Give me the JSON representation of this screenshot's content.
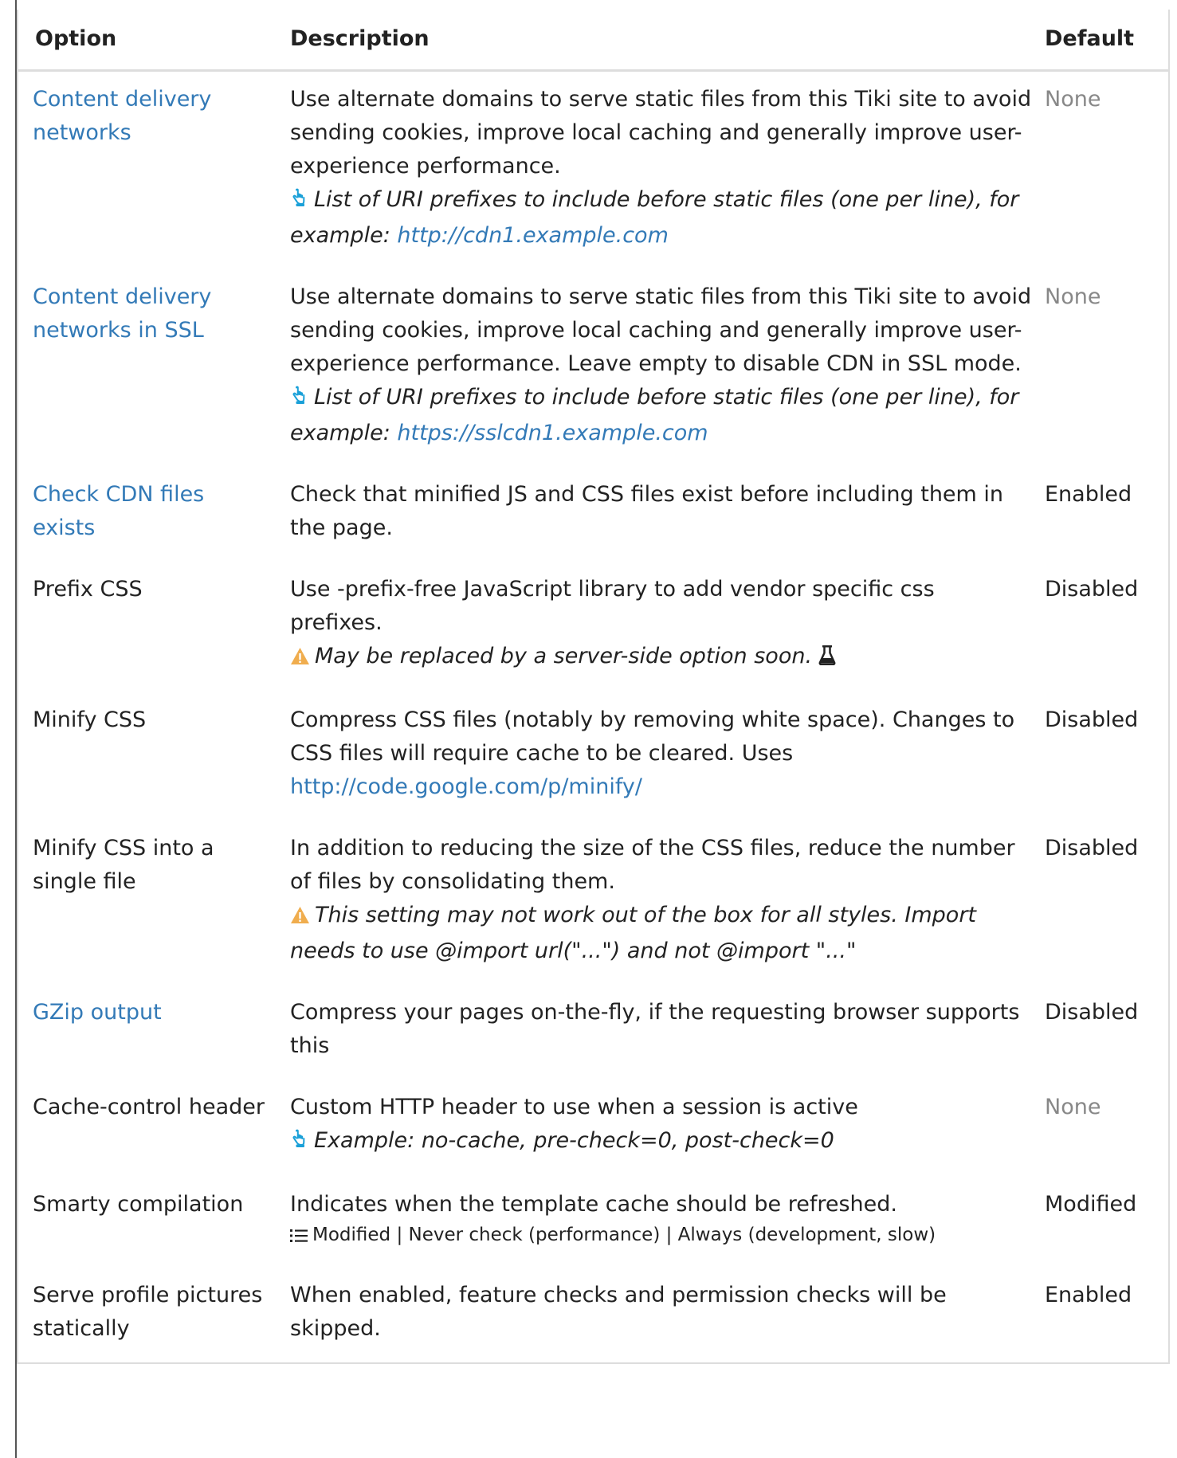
{
  "headers": {
    "option": "Option",
    "description": "Description",
    "default": "Default"
  },
  "rows": [
    {
      "option": "Content delivery networks",
      "option_is_link": true,
      "description": "Use alternate domains to serve static files from this Tiki site to avoid sending cookies, improve local caching and generally improve user-experience performance.",
      "hint": "List of URI prefixes to include before static files (one per line), for example: ",
      "hint_link": "http://cdn1.example.com",
      "default": "None"
    },
    {
      "option": "Content delivery networks in SSL",
      "option_is_link": true,
      "description": "Use alternate domains to serve static files from this Tiki site to avoid sending cookies, improve local caching and generally improve user-experience performance. Leave empty to disable CDN in SSL mode.",
      "hint": "List of URI prefixes to include before static files (one per line), for example: ",
      "hint_link": "https://sslcdn1.example.com",
      "default": "None"
    },
    {
      "option": "Check CDN files exists",
      "option_is_link": true,
      "description": "Check that minified JS and CSS files exist before including them in the page.",
      "default": "Enabled"
    },
    {
      "option": "Prefix CSS",
      "option_is_link": false,
      "description": "Use -prefix-free JavaScript library to add vendor specific css prefixes.",
      "warning": "May be replaced by a server-side option soon.",
      "default": "Disabled"
    },
    {
      "option": "Minify CSS",
      "option_is_link": false,
      "description": "Compress CSS files (notably by removing white space). Changes to CSS files will require cache to be cleared. Uses ",
      "description_link": "http://code.google.com/p/minify/",
      "default": "Disabled"
    },
    {
      "option": "Minify CSS into a single file",
      "option_is_link": false,
      "description": "In addition to reducing the size of the CSS files, reduce the number of files by consolidating them.",
      "warning": "This setting may not work out of the box for all styles. Import needs to use @import url(\"...\") and not @import \"...\"",
      "default": "Disabled"
    },
    {
      "option": "GZip output",
      "option_is_link": true,
      "description": "Compress your pages on-the-fly, if the requesting browser supports this",
      "default": "Disabled"
    },
    {
      "option": "Cache-control header",
      "option_is_link": false,
      "description": "Custom HTTP header to use when a session is active",
      "hint": "Example: no-cache, pre-check=0, post-check=0",
      "default": "None"
    },
    {
      "option": "Smarty compilation",
      "option_is_link": false,
      "description": "Indicates when the template cache should be refreshed.",
      "options": "Modified | Never check (performance) | Always (development, slow)",
      "default": "Modified"
    },
    {
      "option": "Serve profile pictures statically",
      "option_is_link": false,
      "description": "When enabled, feature checks and permission checks will be skipped.",
      "default": "Enabled"
    }
  ],
  "colors": {
    "link": "#337ab7",
    "muted": "#888888",
    "hint_icon": "#1aa0d8",
    "warning_icon": "#f0ad4e",
    "border": "#dddddd"
  },
  "icons": {
    "hint": "hand-pointer-icon",
    "warning": "warning-icon",
    "experimental": "flask-icon",
    "options": "list-icon"
  }
}
